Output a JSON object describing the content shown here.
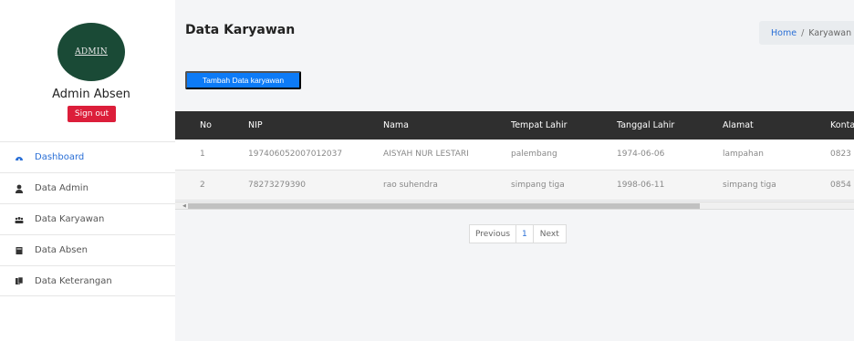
{
  "sidebar": {
    "avatar_text": "ADMIN",
    "admin_name": "Admin Absen",
    "signout_label": "Sign out",
    "items": [
      {
        "label": "Dashboard",
        "icon": "dashboard-icon",
        "active": true
      },
      {
        "label": "Data Admin",
        "icon": "user-icon",
        "active": false
      },
      {
        "label": "Data Karyawan",
        "icon": "users-icon",
        "active": false
      },
      {
        "label": "Data Absen",
        "icon": "book-icon",
        "active": false
      },
      {
        "label": "Data Keterangan",
        "icon": "copy-icon",
        "active": false
      }
    ]
  },
  "header": {
    "title": "Data Karyawan",
    "breadcrumb": {
      "home": "Home",
      "separator": "/",
      "current": "Karyawan"
    }
  },
  "toolbar": {
    "add_label": "Tambah Data karyawan"
  },
  "table": {
    "columns": [
      "No",
      "NIP",
      "Nama",
      "Tempat Lahir",
      "Tanggal Lahir",
      "Alamat",
      "Kontak"
    ],
    "rows": [
      [
        "1",
        "197406052007012037",
        "AISYAH NUR LESTARI",
        "palembang",
        "1974-06-06",
        "lampahan",
        "0823"
      ],
      [
        "2",
        "78273279390",
        "rao suhendra",
        "simpang tiga",
        "1998-06-11",
        "simpang tiga",
        "0854"
      ]
    ]
  },
  "pagination": {
    "previous_label": "Previous",
    "current_page": "1",
    "next_label": "Next"
  },
  "colors": {
    "accent": "#0d7bf7",
    "danger": "#dc1e3a",
    "avatar_bg": "#1a4a36",
    "table_header": "#2f2f2f",
    "link": "#2a6fd6"
  }
}
